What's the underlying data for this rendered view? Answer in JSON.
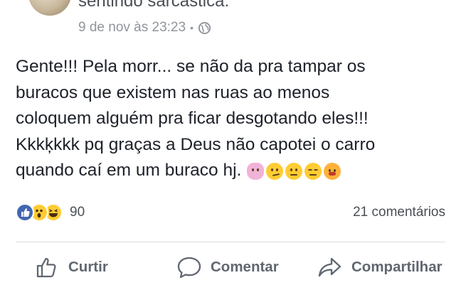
{
  "post": {
    "author_status_text": "sentindo sarcástica.",
    "timestamp": "9 de nov às 23:23",
    "meta_separator": "•",
    "privacy_icon": "globe-icon",
    "text_lines": [
      "Gente!!! Pela morr... se não da pra tampar os",
      "buracos que existem nas ruas ao menos",
      "coloquem alguém pra ficar desgotando eles!!!",
      "Kkkķkkk pq graças a Deus não capotei o carro",
      "quando caí em um buraco hj."
    ],
    "emojis": [
      "face-palm-emoji",
      "thinking-face-emoji",
      "neutral-face-emoji",
      "expressionless-face-emoji",
      "persevering-face-emoji"
    ]
  },
  "stats": {
    "reactions": [
      "like-reaction-icon",
      "wow-reaction-icon",
      "haha-reaction-icon"
    ],
    "reaction_count": "90",
    "comments_count": "21 comentários"
  },
  "actions": {
    "like_label": "Curtir",
    "comment_label": "Comentar",
    "share_label": "Compartilhar"
  },
  "colors": {
    "text": "#1d2129",
    "secondary": "#90949c",
    "action": "#606770",
    "like_blue": "#4267b2",
    "emoji_yellow": "#ffcc33"
  }
}
